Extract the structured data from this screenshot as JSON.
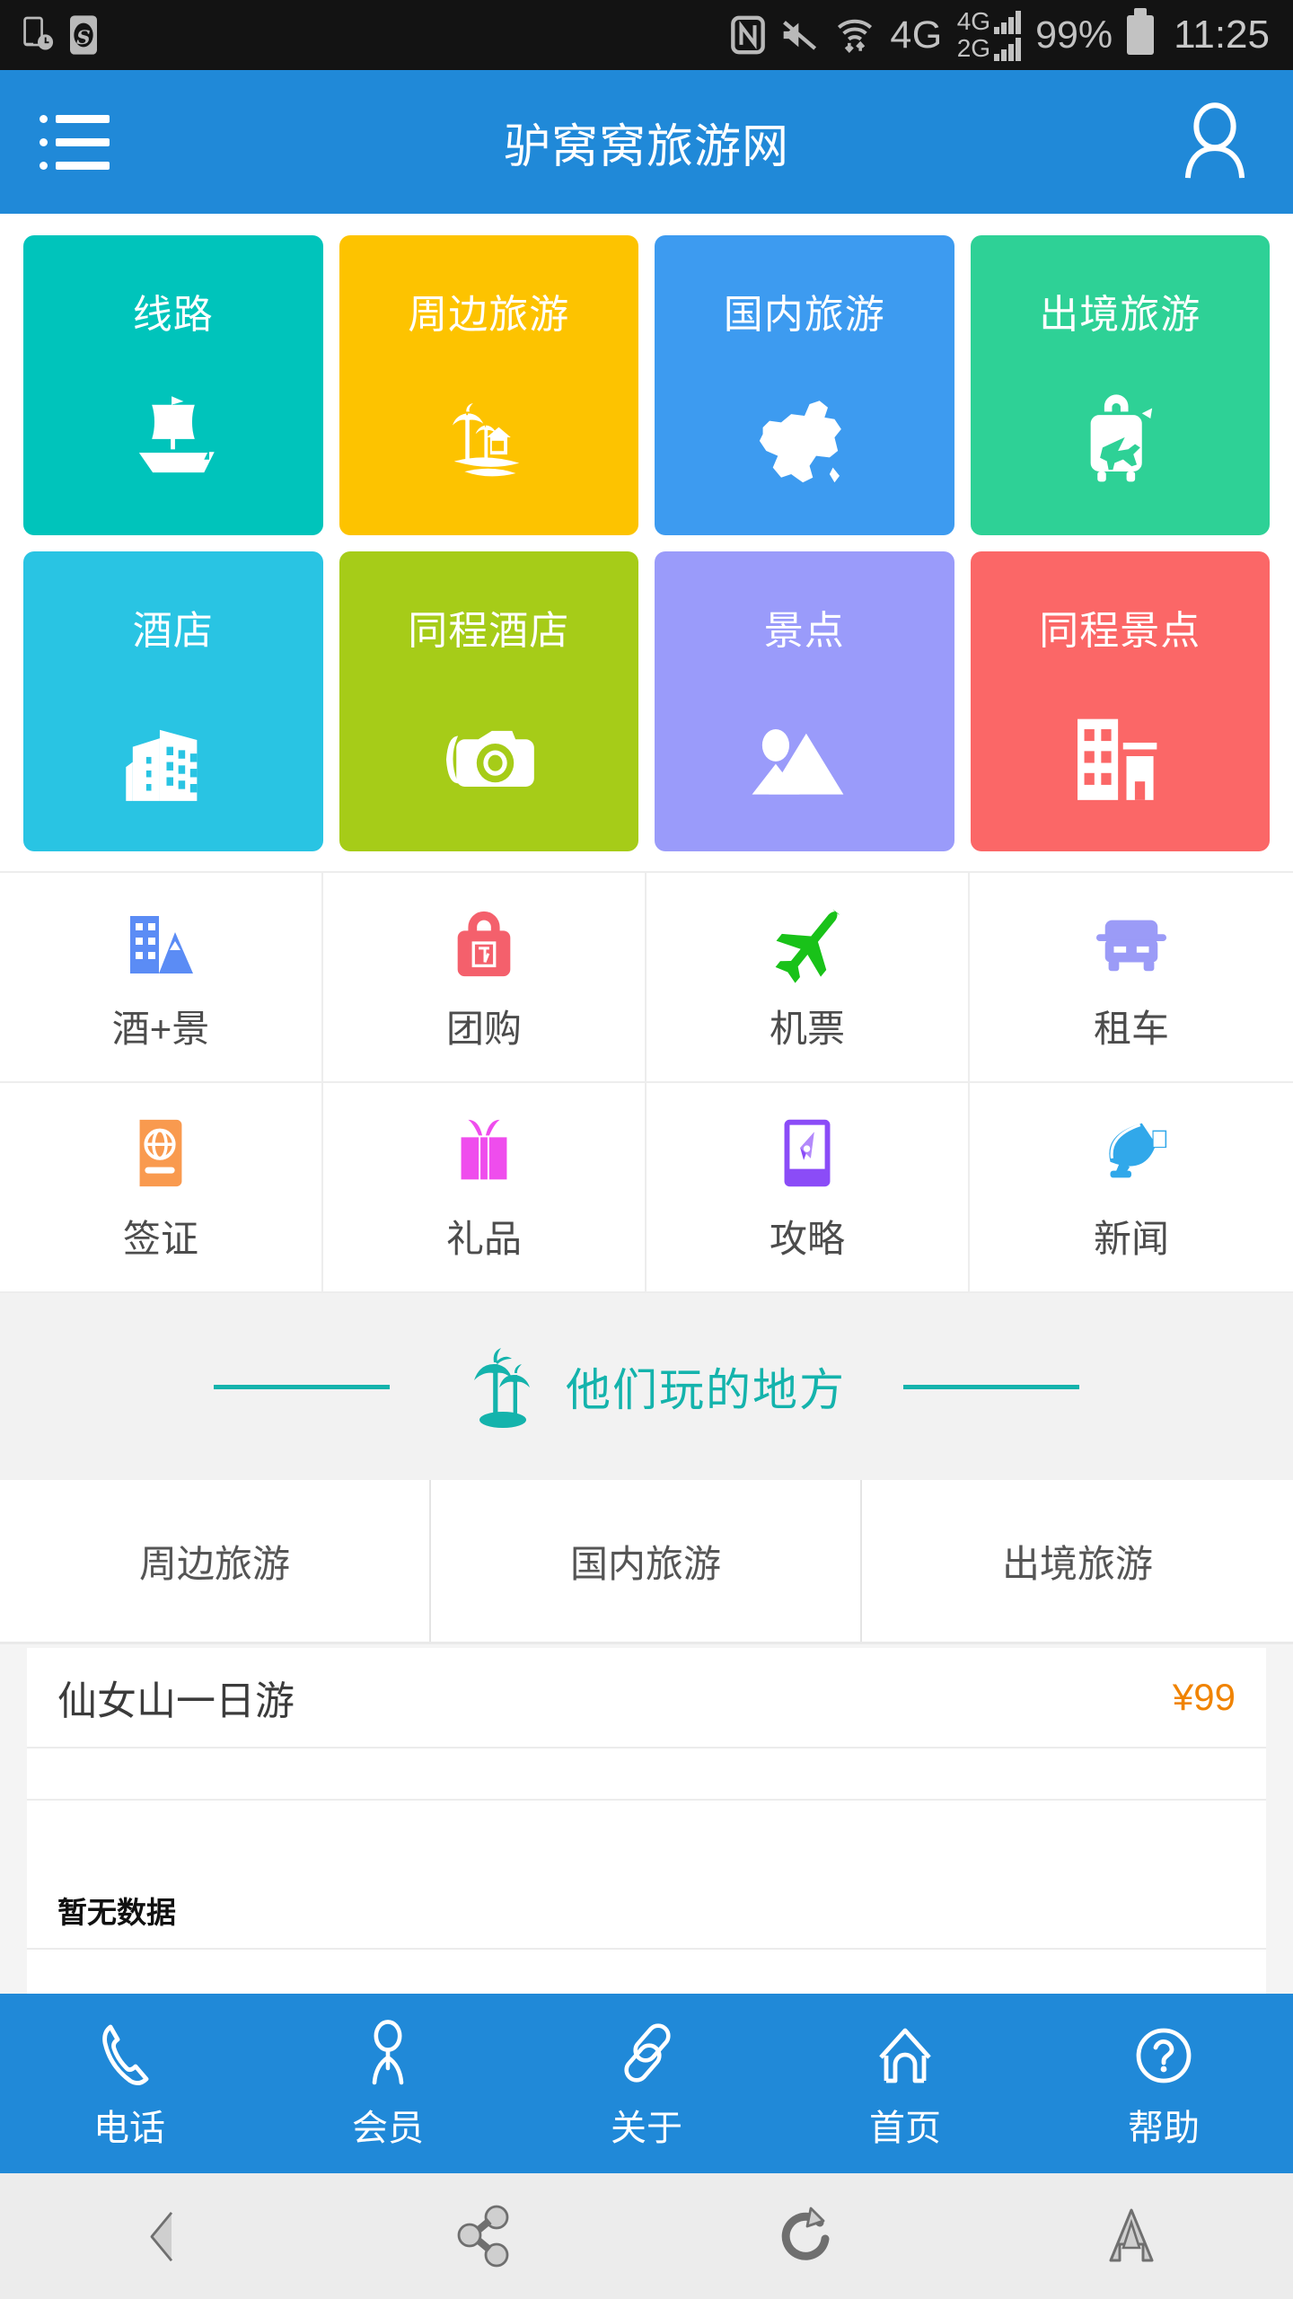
{
  "status_bar": {
    "left_icons": [
      "phone-clock-icon",
      "s-badge-icon"
    ],
    "right_icons": [
      "nfc-icon",
      "mute-icon",
      "wifi-transfer-icon"
    ],
    "network_label": "4G",
    "sim1_label": "4G",
    "sim2_label": "2G",
    "battery_percent": "99%",
    "clock": "11:25"
  },
  "header": {
    "menu_icon": "list-menu-icon",
    "title": "驴窝窝旅游网",
    "account_icon": "user-account-icon",
    "bg_color": "#2089d8"
  },
  "tiles": [
    {
      "label": "线路",
      "color": "#00c4bb",
      "icon": "sailboat-icon"
    },
    {
      "label": "周边旅游",
      "color": "#fdc300",
      "icon": "island-palm-house-icon"
    },
    {
      "label": "国内旅游",
      "color": "#3d9bf0",
      "icon": "china-map-icon"
    },
    {
      "label": "出境旅游",
      "color": "#2ed196",
      "icon": "suitcase-plane-icon"
    },
    {
      "label": "酒店",
      "color": "#29c4e3",
      "icon": "buildings-icon"
    },
    {
      "label": "同程酒店",
      "color": "#a6cc18",
      "icon": "camera-icon"
    },
    {
      "label": "景点",
      "color": "#9a9bfa",
      "icon": "mountain-landscape-icon"
    },
    {
      "label": "同程景点",
      "color": "#fb6767",
      "icon": "hotel-building-icon"
    }
  ],
  "quick_icons": [
    {
      "label": "酒+景",
      "icon": "building-mountain-icon",
      "color": "#5b8cf5"
    },
    {
      "label": "团购",
      "icon": "shopping-bag-tuan-icon",
      "color": "#f4606c"
    },
    {
      "label": "机票",
      "icon": "airplane-icon",
      "color": "#19c219"
    },
    {
      "label": "租车",
      "icon": "car-van-icon",
      "color": "#9b9bf7"
    },
    {
      "label": "签证",
      "icon": "passport-globe-icon",
      "color": "#f99a4f"
    },
    {
      "label": "礼品",
      "icon": "gift-box-icon",
      "color": "#ef4ded"
    },
    {
      "label": "攻略",
      "icon": "compass-guide-icon",
      "color": "#8b4cf7"
    },
    {
      "label": "新闻",
      "icon": "satellite-dish-icon",
      "color": "#31a8ea"
    }
  ],
  "section": {
    "title": "他们玩的地方",
    "icon": "palm-tree-icon",
    "accent_color": "#14b3ac"
  },
  "tabs": [
    {
      "label": "周边旅游",
      "active": true
    },
    {
      "label": "国内旅游",
      "active": false
    },
    {
      "label": "出境旅游",
      "active": false
    }
  ],
  "list": {
    "items": [
      {
        "title": "仙女山一日游",
        "price": "¥99"
      }
    ],
    "empty_text": "暂无数据"
  },
  "bottom_nav": [
    {
      "label": "电话",
      "icon": "phone-icon"
    },
    {
      "label": "会员",
      "icon": "member-person-icon"
    },
    {
      "label": "关于",
      "icon": "link-chain-icon"
    },
    {
      "label": "首页",
      "icon": "home-icon"
    },
    {
      "label": "帮助",
      "icon": "help-question-icon"
    }
  ],
  "system_nav": [
    {
      "icon": "back-chevron-icon"
    },
    {
      "icon": "share-icon"
    },
    {
      "icon": "refresh-icon"
    },
    {
      "icon": "home-house-icon"
    }
  ]
}
